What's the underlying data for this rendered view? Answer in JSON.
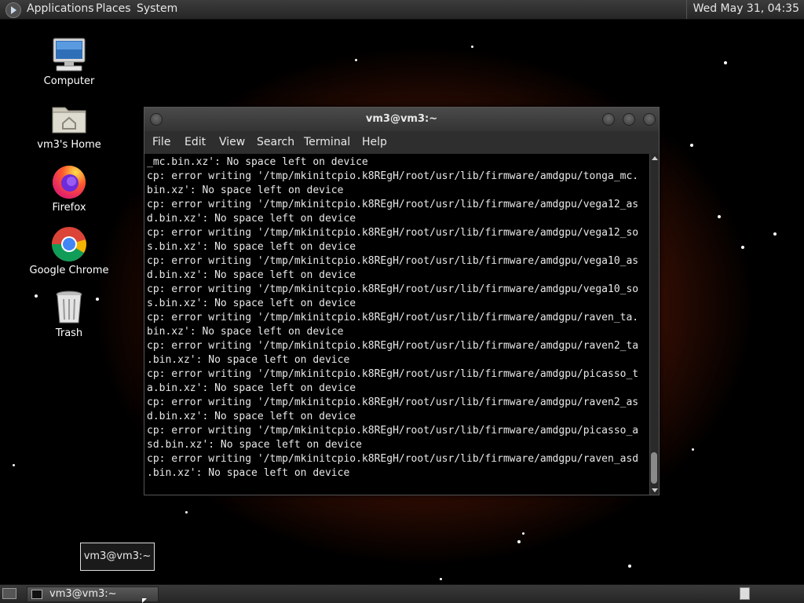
{
  "top_panel": {
    "menus": [
      "Applications",
      "Places",
      "System"
    ],
    "clock": "Wed May 31, 04:35"
  },
  "desktop_icons": [
    {
      "label": "Computer",
      "icon": "computer-icon"
    },
    {
      "label": "vm3's Home",
      "icon": "home-folder-icon"
    },
    {
      "label": "Firefox",
      "icon": "firefox-icon"
    },
    {
      "label": "Google Chrome",
      "icon": "chrome-icon"
    },
    {
      "label": "Trash",
      "icon": "trash-icon"
    }
  ],
  "terminal": {
    "title": "vm3@vm3:~",
    "menus": [
      "File",
      "Edit",
      "View",
      "Search",
      "Terminal",
      "Help"
    ],
    "lines": [
      "_mc.bin.xz': No space left on device",
      "cp: error writing '/tmp/mkinitcpio.k8REgH/root/usr/lib/firmware/amdgpu/tonga_mc.",
      "bin.xz': No space left on device",
      "cp: error writing '/tmp/mkinitcpio.k8REgH/root/usr/lib/firmware/amdgpu/vega12_as",
      "d.bin.xz': No space left on device",
      "cp: error writing '/tmp/mkinitcpio.k8REgH/root/usr/lib/firmware/amdgpu/vega12_so",
      "s.bin.xz': No space left on device",
      "cp: error writing '/tmp/mkinitcpio.k8REgH/root/usr/lib/firmware/amdgpu/vega10_as",
      "d.bin.xz': No space left on device",
      "cp: error writing '/tmp/mkinitcpio.k8REgH/root/usr/lib/firmware/amdgpu/vega10_so",
      "s.bin.xz': No space left on device",
      "cp: error writing '/tmp/mkinitcpio.k8REgH/root/usr/lib/firmware/amdgpu/raven_ta.",
      "bin.xz': No space left on device",
      "cp: error writing '/tmp/mkinitcpio.k8REgH/root/usr/lib/firmware/amdgpu/raven2_ta",
      ".bin.xz': No space left on device",
      "cp: error writing '/tmp/mkinitcpio.k8REgH/root/usr/lib/firmware/amdgpu/picasso_t",
      "a.bin.xz': No space left on device",
      "cp: error writing '/tmp/mkinitcpio.k8REgH/root/usr/lib/firmware/amdgpu/raven2_as",
      "d.bin.xz': No space left on device",
      "cp: error writing '/tmp/mkinitcpio.k8REgH/root/usr/lib/firmware/amdgpu/picasso_a",
      "sd.bin.xz': No space left on device",
      "cp: error writing '/tmp/mkinitcpio.k8REgH/root/usr/lib/firmware/amdgpu/raven_asd",
      ".bin.xz': No space left on device"
    ]
  },
  "tooltip": {
    "text": "vm3@vm3:~"
  },
  "taskbar": {
    "task_label": "vm3@vm3:~"
  },
  "colors": {
    "terminal_bg": "#000000",
    "terminal_fg": "#e8e8e8",
    "panel_bg": "#2e2e2e"
  }
}
